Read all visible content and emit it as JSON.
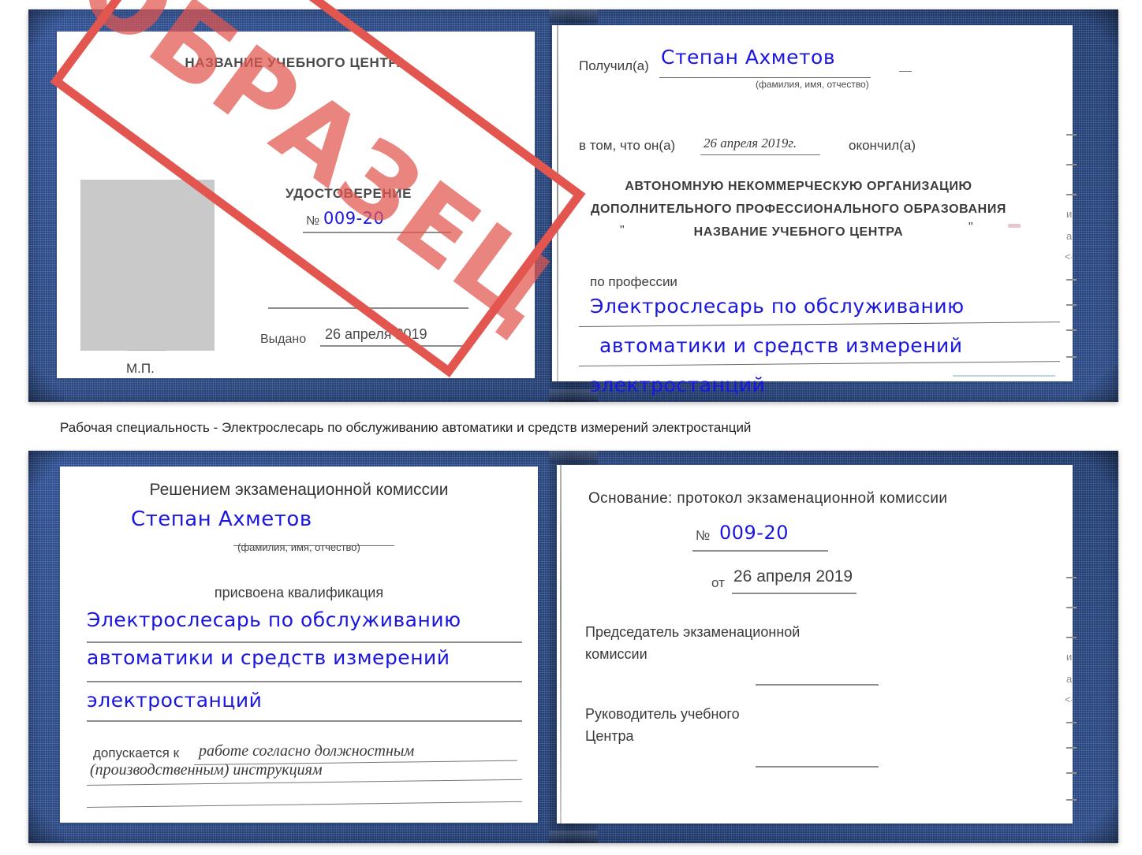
{
  "document": {
    "type": "Удостоверение",
    "watermark": "ОБРАЗЕЦ",
    "accent_blue": "#1a16e0",
    "cover_blue": "#27457f",
    "watermark_red": "#e2564f",
    "photo_placeholder_gray": "#c9c9c9"
  },
  "caption": {
    "text": "Рабочая специальность - Электрослесарь по обслуживанию автоматики и средств измерений электростанций"
  },
  "certificate_top": {
    "left_page": {
      "center_name": "НАЗВАНИЕ УЧЕБНОГО ЦЕНТРА",
      "doc_title": "УДОСТОВЕРЕНИЕ",
      "number_label": "№",
      "number_value": "009-20",
      "issued_label": "Выдано",
      "issued_value": "26 апреля 2019",
      "stamp_label": "М.П.",
      "photo_placeholder": ""
    },
    "right_page": {
      "received_label": "Получил(а)",
      "received_value": "Степан Ахметов",
      "fio_hint": "(фамилия, имя, отчество)",
      "that_he_label": "в том, что он(а)",
      "that_he_value": "26 апреля 2019г.",
      "finished_label": "окончил(а)",
      "org_line1": "АВТОНОМНУЮ НЕКОММЕРЧЕСКУЮ ОРГАНИЗАЦИЮ",
      "org_line2": "ДОПОЛНИТЕЛЬНОГО ПРОФЕССИОНАЛЬНОГО ОБРАЗОВАНИЯ",
      "org_quote_open": "\"",
      "org_line3": "НАЗВАНИЕ УЧЕБНОГО ЦЕНТРА",
      "org_quote_close": "\"",
      "profession_label": "по профессии",
      "profession_line1": "Электрослесарь по обслуживанию",
      "profession_line2": "автоматики и средств измерений",
      "profession_line3": "электростанций",
      "bleed_chars": [
        "и",
        "а",
        "<-"
      ]
    }
  },
  "certificate_bottom": {
    "left_page": {
      "heading": "Решением экзаменационной комиссии",
      "name_value": "Степан Ахметов",
      "fio_hint": "(фамилия, имя, отчество)",
      "qualification_label": "присвоена квалификация",
      "qualification_line1": "Электрослесарь по обслуживанию",
      "qualification_line2": "автоматики и средств измерений",
      "qualification_line3": "электростанций",
      "admitted_label": "допускается к",
      "admitted_value_line1": "работе согласно должностным",
      "admitted_value_line2": "(производственным) инструкциям"
    },
    "right_page": {
      "basis_label": "Основание: протокол экзаменационной комиссии",
      "number_label": "№",
      "number_value": "009-20",
      "date_label": "от",
      "date_value": "26 апреля 2019",
      "chairman_line1": "Председатель экзаменационной",
      "chairman_line2": "комиссии",
      "head_line1": "Руководитель учебного",
      "head_line2": "Центра",
      "bleed_chars": [
        "и",
        "а",
        "<-"
      ]
    }
  }
}
